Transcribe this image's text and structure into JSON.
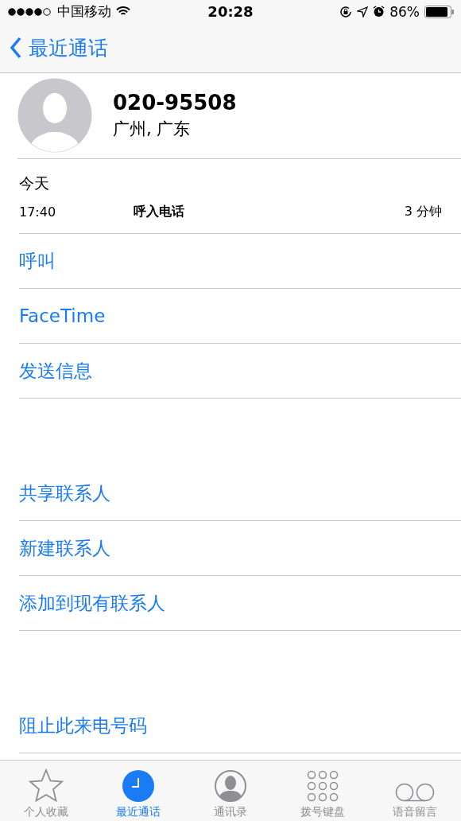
{
  "status_bar": {
    "carrier": "中国移动",
    "time": "20:28",
    "battery": "86%"
  },
  "nav": {
    "back": "最近通话"
  },
  "contact": {
    "number": "020-95508",
    "location": "广州, 广东"
  },
  "call_log": {
    "date": "今天",
    "entries": [
      {
        "time": "17:40",
        "type": "呼入电话",
        "duration": "3 分钟"
      }
    ]
  },
  "action_groups": [
    [
      "呼叫",
      "FaceTime",
      "发送信息"
    ],
    [
      "共享联系人",
      "新建联系人",
      "添加到现有联系人"
    ],
    [
      "阻止此来电号码"
    ]
  ],
  "tabs": [
    {
      "label": "个人收藏",
      "kind": "star",
      "selected": false
    },
    {
      "label": "最近通话",
      "kind": "clock",
      "selected": true
    },
    {
      "label": "通讯录",
      "kind": "person",
      "selected": false
    },
    {
      "label": "拨号键盘",
      "kind": "keypad",
      "selected": false
    },
    {
      "label": "语音留言",
      "kind": "voicemail",
      "selected": false
    }
  ]
}
